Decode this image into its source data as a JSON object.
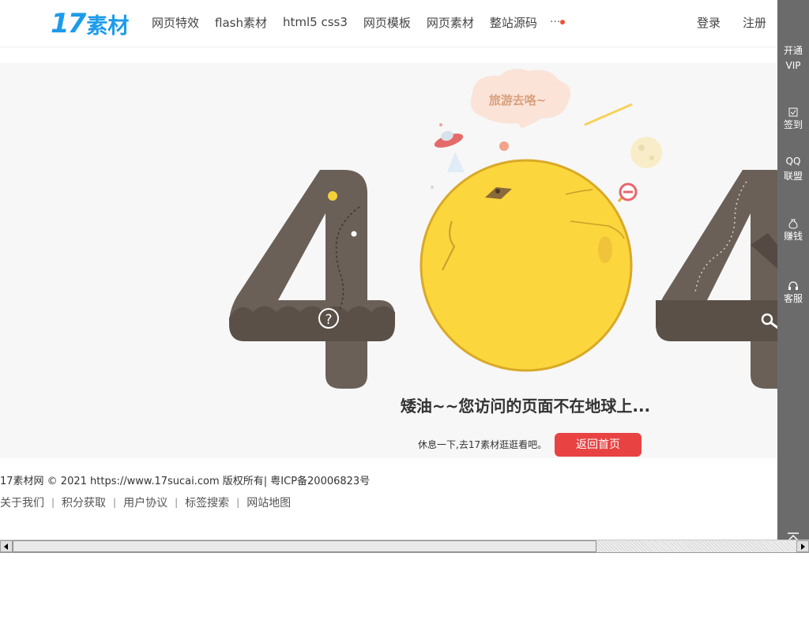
{
  "header": {
    "logo_num": "17",
    "logo_text": "素材",
    "nav": [
      "网页特效",
      "flash素材",
      "html5 css3",
      "网页模板",
      "网页素材",
      "整站源码"
    ],
    "more": "···",
    "login": "登录",
    "register": "注册"
  },
  "main": {
    "cloud_text": "旅游去咯~",
    "message": "矮油~~您访问的页面不在地球上...",
    "sub_text": "休息一下,去17素材逛逛看吧。",
    "home_button": "返回首页"
  },
  "footer": {
    "copyright": "17素材网 © 2021 https://www.17sucai.com 版权所有| 粤ICP备20006823号",
    "links": [
      "关于我们",
      "积分获取",
      "用户协议",
      "标签搜索",
      "网站地图"
    ],
    "separator": "|"
  },
  "sidebar": {
    "vip_line1": "开通",
    "vip_line2": "VIP",
    "signin": "签到",
    "qq_line1": "QQ",
    "qq_line2": "联盟",
    "earn": "赚钱",
    "service": "客服"
  },
  "colors": {
    "brand": "#1c9bea",
    "button": "#e94242",
    "digit": "#6a6058",
    "moon": "#fbd63d",
    "sidebar": "#6b6b6b"
  }
}
